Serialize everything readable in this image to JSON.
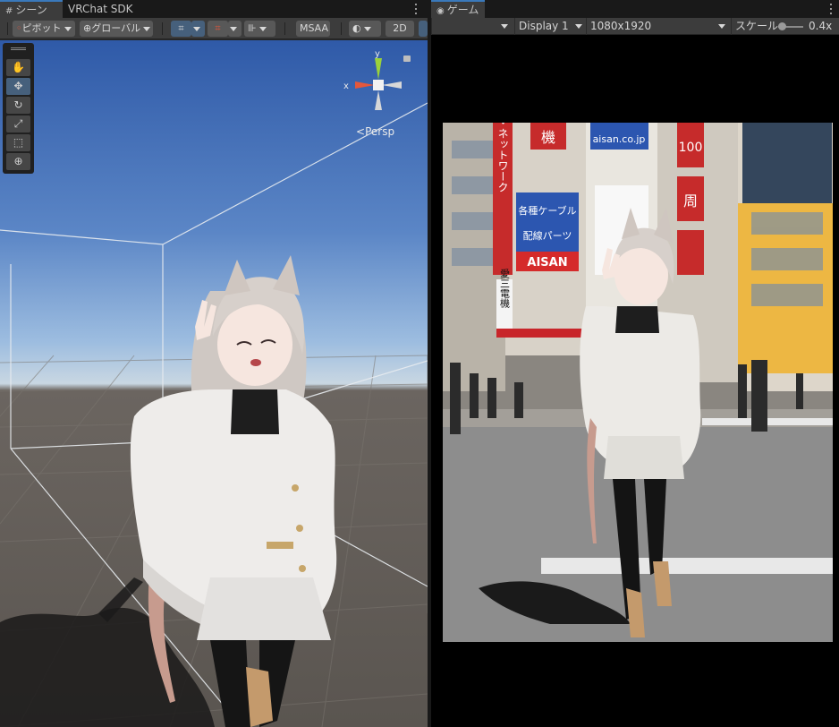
{
  "scene": {
    "tabs": [
      {
        "label": "シーン",
        "active": true
      },
      {
        "label": "VRChat SDK",
        "active": false
      }
    ],
    "toolbar": {
      "pivot": "ピボット",
      "space": "グローバル",
      "msaa": "MSAA",
      "two_d": "2D"
    },
    "persp_label": "Persp",
    "axis_x": "x",
    "axis_y": "y"
  },
  "game": {
    "tab": "ゲーム",
    "display": "Display 1",
    "resolution": "1080x1920",
    "scale_label": "スケール",
    "scale_value": "0.4x"
  },
  "signs": {
    "s1": "各種ケーブル",
    "s2": "配線パーツ",
    "s3": "AISAN",
    "s4": "aisan.co.jp",
    "s5": "ル・ネットワーク",
    "s6": "愛三電機",
    "s7": "機",
    "s8": "100",
    "s9": "周"
  },
  "colors": {
    "accent": "#3a79bb",
    "selected_button": "#46607c",
    "panel_bg": "#3c3c3c"
  }
}
